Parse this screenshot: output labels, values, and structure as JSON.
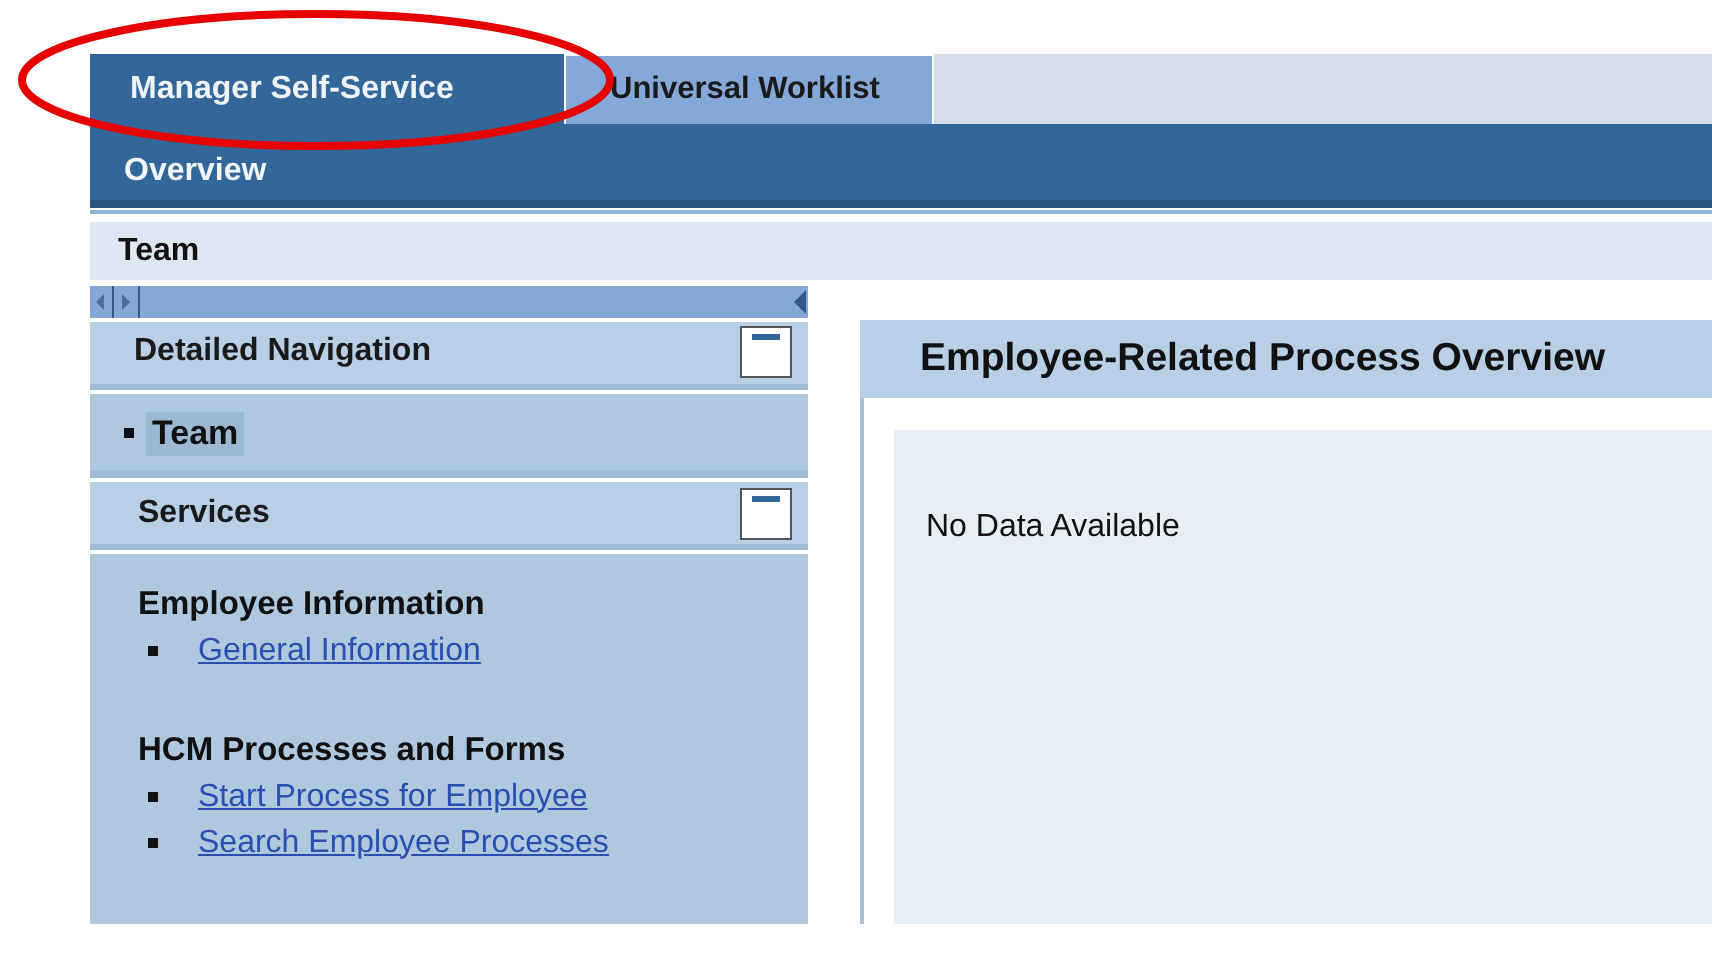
{
  "tabs": [
    {
      "label": "Manager Self-Service",
      "selected": true
    },
    {
      "label": "Universal Worklist",
      "selected": false
    }
  ],
  "subnav": {
    "label": "Overview"
  },
  "breadcrumb": "Team",
  "detailed_navigation": {
    "title": "Detailed Navigation",
    "expanded": true,
    "items": [
      {
        "label": "Team",
        "selected": true
      }
    ]
  },
  "services": {
    "title": "Services",
    "expanded": true,
    "groups": [
      {
        "title": "Employee Information",
        "links": [
          "General Information"
        ]
      },
      {
        "title": "HCM Processes and Forms",
        "links": [
          "Start Process for Employee",
          "Search Employee Processes"
        ]
      }
    ]
  },
  "overview": {
    "title": "Employee-Related Process Overview",
    "message": "No Data Available"
  },
  "annotation": {
    "kind": "ellipse"
  }
}
